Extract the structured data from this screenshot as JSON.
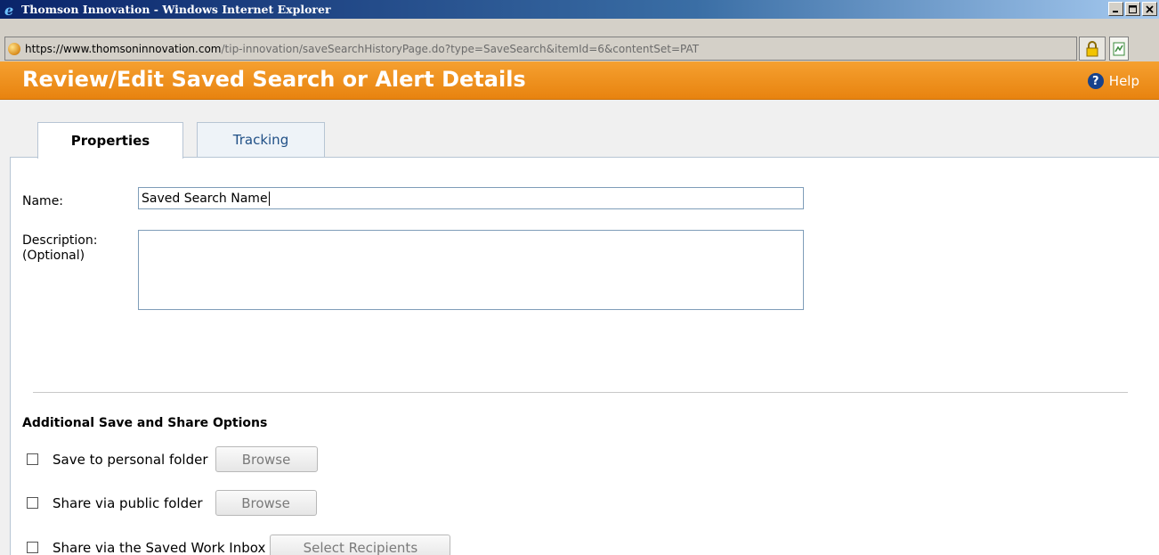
{
  "window": {
    "title": "Thomson Innovation - Windows Internet Explorer"
  },
  "address": {
    "scheme": "https://",
    "host": "www.thomsoninnovation.com",
    "path": "/tip-innovation/saveSearchHistoryPage.do?type=SaveSearch&itemId=6&contentSet=PAT"
  },
  "header": {
    "title": "Review/Edit Saved Search or Alert Details",
    "help_label": "Help",
    "help_icon": "?"
  },
  "tabs": [
    {
      "label": "Properties",
      "active": true
    },
    {
      "label": "Tracking",
      "active": false
    }
  ],
  "form": {
    "name_label": "Name:",
    "name_value": "Saved Search Name",
    "description_label_line1": "Description:",
    "description_label_line2": "(Optional)",
    "description_value": ""
  },
  "share": {
    "heading": "Additional Save and Share Options",
    "options": [
      {
        "label": "Save to personal folder",
        "button": "Browse",
        "checked": false
      },
      {
        "label": "Share via public folder",
        "button": "Browse",
        "checked": false
      },
      {
        "label": "Share via the Saved Work Inbox",
        "button": "Select Recipients",
        "checked": false
      }
    ]
  },
  "colors": {
    "header_orange": "#e8830f",
    "title_bar_blue": "#0a246a",
    "tab_link_blue": "#1f4f86"
  }
}
